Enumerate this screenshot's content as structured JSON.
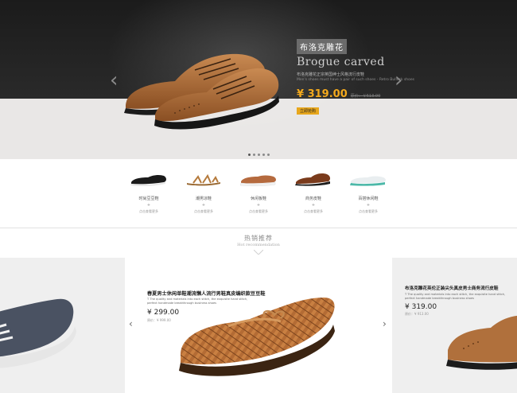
{
  "hero": {
    "badge": "布洛克雕花",
    "title": "Brogue carved",
    "subtitle_cn": "布洛克雕花正宗英国绅士风格流行皮鞋",
    "subtitle_en": "Men's shoes must have a pair of such shoes - Retro Bullock shoes",
    "price": "¥ 319.00",
    "old_price": "原价：￥513.00",
    "buy_label": "立即抢购",
    "arrow_left": "‹",
    "arrow_right": "›",
    "slide_count": 5,
    "active_slide": 0,
    "icon": "brogue-shoe-icon",
    "accent": "#f3a91d"
  },
  "categories": [
    {
      "name": "时尚豆豆鞋",
      "plus": "+",
      "sub": "点击查看更多",
      "icon": "loafer-black-icon"
    },
    {
      "name": "潮男凉鞋",
      "plus": "+",
      "sub": "点击查看更多",
      "icon": "sandal-icon"
    },
    {
      "name": "休闲板鞋",
      "plus": "+",
      "sub": "点击查看更多",
      "icon": "casual-shoe-icon"
    },
    {
      "name": "商务皮鞋",
      "plus": "+",
      "sub": "点击查看更多",
      "icon": "business-shoe-icon"
    },
    {
      "name": "百搭休闲鞋",
      "plus": "+",
      "sub": "点击查看更多",
      "icon": "slipon-icon"
    }
  ],
  "section": {
    "title": "热销推荐",
    "subtitle": "Hot recommendation"
  },
  "products": [
    {
      "title": "春夏男士休闲单鞋潮流懒人流行男鞋真皮编织款豆豆鞋",
      "desc": "T The quality and materials into each stitch, the exquisite hand stitch, perfect handmade breakthrough business shoes",
      "price": "¥ 299.00",
      "old_price": "原价：¥ 999.00",
      "icon": "woven-loafer-icon"
    },
    {
      "title": "布洛克雕花英伦正装尖头真皮男士商务流行皮鞋",
      "desc": "T The quality and materials into each stitch, the exquisite hand stitch, perfect handmade breakthrough business shoes",
      "price": "¥ 319.00",
      "old_price": "原价：¥ 913.00",
      "icon": "brogue-shoe-icon"
    }
  ],
  "carousel": {
    "arrow_left": "‹",
    "arrow_right": "›"
  }
}
